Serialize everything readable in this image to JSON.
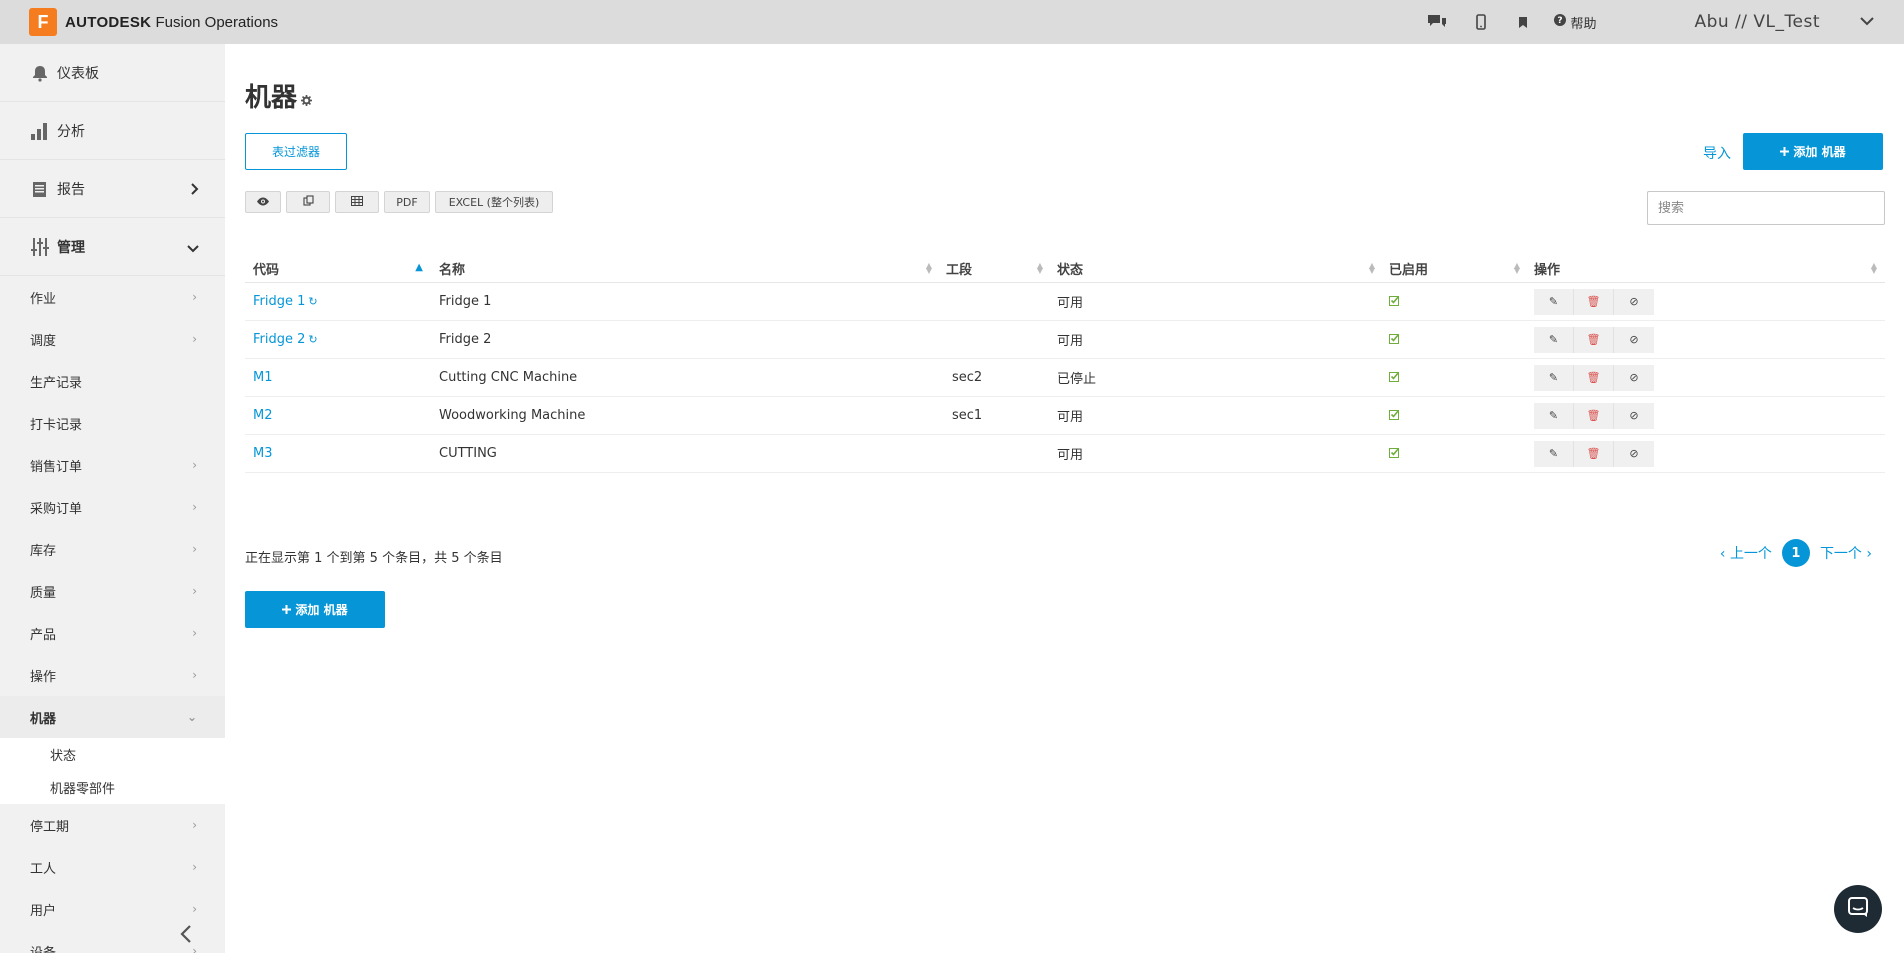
{
  "app": {
    "logo_letter": "F",
    "brand_bold": "AUTODESK",
    "brand_rest": "Fusion Operations",
    "help_label": "帮助",
    "user_label": "Abu // VL_Test"
  },
  "sidebar": {
    "top": [
      {
        "label": "仪表板",
        "icon": "bell-icon"
      },
      {
        "label": "分析",
        "icon": "bar-chart-icon"
      },
      {
        "label": "报告",
        "icon": "report-icon"
      },
      {
        "label": "管理",
        "icon": "sliders-icon"
      }
    ],
    "items": [
      {
        "label": "作业"
      },
      {
        "label": "调度"
      },
      {
        "label": "生产记录"
      },
      {
        "label": "打卡记录"
      },
      {
        "label": "销售订单"
      },
      {
        "label": "采购订单"
      },
      {
        "label": "库存"
      },
      {
        "label": "质量"
      },
      {
        "label": "产品"
      },
      {
        "label": "操作"
      },
      {
        "label": "机器"
      },
      {
        "label": "停工期"
      },
      {
        "label": "工人"
      },
      {
        "label": "用户"
      },
      {
        "label": "设备"
      }
    ],
    "sub_items": [
      {
        "label": "状态"
      },
      {
        "label": "机器零部件"
      }
    ]
  },
  "page": {
    "title": "机器",
    "filter_button": "表过滤器",
    "import_label": "导入",
    "add_button": "添加 机器",
    "search_placeholder": "搜索",
    "tools": {
      "pdf": "PDF",
      "excel": "EXCEL (整个列表)"
    }
  },
  "table": {
    "columns": [
      "代码",
      "名称",
      "工段",
      "状态",
      "已启用",
      "操作"
    ],
    "rows": [
      {
        "code": "Fridge 1",
        "name": "Fridge 1",
        "section": "",
        "status": "可用",
        "enabled": true
      },
      {
        "code": "Fridge 2",
        "name": "Fridge 2",
        "section": "",
        "status": "可用",
        "enabled": true
      },
      {
        "code": "M1",
        "name": "Cutting CNC Machine",
        "section": "sec2",
        "status": "已停止",
        "enabled": true
      },
      {
        "code": "M2",
        "name": "Woodworking Machine",
        "section": "sec1",
        "status": "可用",
        "enabled": true
      },
      {
        "code": "M3",
        "name": "CUTTING",
        "section": "",
        "status": "可用",
        "enabled": true
      }
    ],
    "info": "正在显示第 1 个到第 5 个条目，共 5 个条目"
  },
  "pager": {
    "prev": "上一个",
    "current": "1",
    "next": "下一个"
  },
  "colors": {
    "accent": "#0696d7",
    "topbar": "#dcdcdc",
    "sidebar": "#f1f1f1",
    "enabled_check": "#6fae3c",
    "delete": "#d9534f"
  }
}
